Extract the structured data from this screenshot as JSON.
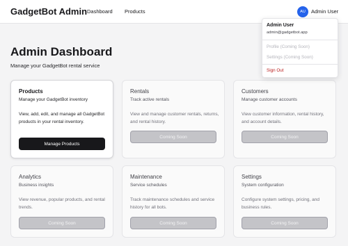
{
  "header": {
    "brand": "GadgetBot Admin",
    "nav": {
      "dashboard": "Dashboard",
      "products": "Products"
    },
    "user": {
      "initials": "AU",
      "name": "Admin User"
    }
  },
  "dropdown": {
    "name": "Admin User",
    "email": "admin@gadgetbot.app",
    "profile": "Profile (Coming Soon)",
    "settings": "Settings (Coming Soon)",
    "signout": "Sign Out"
  },
  "page": {
    "title": "Admin Dashboard",
    "subtitle": "Manage your GadgetBot rental service"
  },
  "cards": [
    {
      "title": "Products",
      "subtitle": "Manage your GadgetBot inventory",
      "description": "View, add, edit, and manage all GadgetBot products in your rental inventory.",
      "button": "Manage Products"
    },
    {
      "title": "Rentals",
      "subtitle": "Track active rentals",
      "description": "View and manage customer rentals, returns, and rental history.",
      "button": "Coming Soon"
    },
    {
      "title": "Customers",
      "subtitle": "Manage customer accounts",
      "description": "View customer information, rental history, and account details.",
      "button": "Coming Soon"
    },
    {
      "title": "Analytics",
      "subtitle": "Business insights",
      "description": "View revenue, popular products, and rental trends.",
      "button": "Coming Soon"
    },
    {
      "title": "Maintenance",
      "subtitle": "Service schedules",
      "description": "Track maintenance schedules and service history for all bots.",
      "button": "Coming Soon"
    },
    {
      "title": "Settings",
      "subtitle": "System configuration",
      "description": "Configure system settings, pricing, and business rules.",
      "button": "Coming Soon"
    }
  ]
}
